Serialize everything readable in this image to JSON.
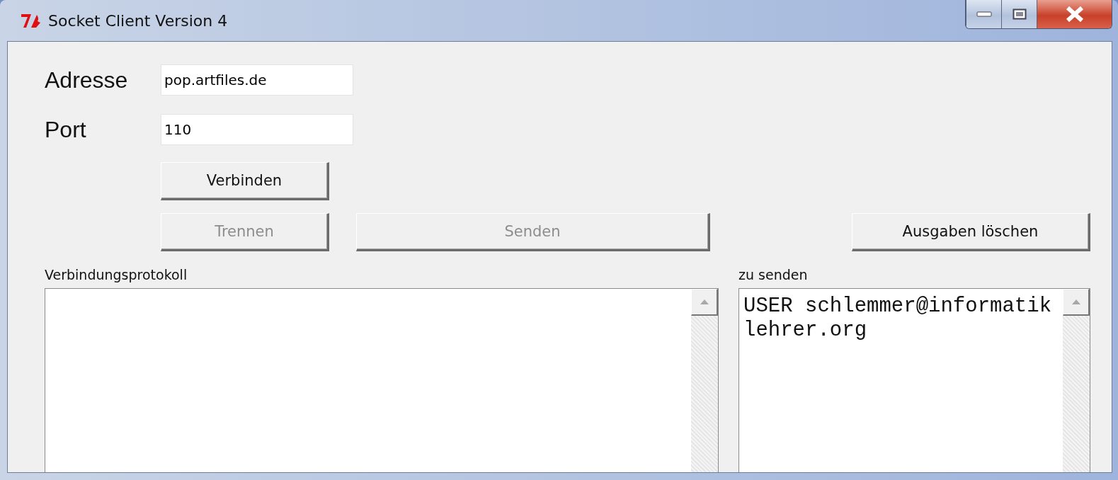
{
  "window": {
    "title": "Socket Client Version 4"
  },
  "fields": [
    {
      "label": "Adresse",
      "value": "pop.artfiles.de"
    },
    {
      "label": "Port",
      "value": "110"
    }
  ],
  "connect_button": {
    "label": "Verbinden",
    "disabled": false
  },
  "action_buttons": [
    {
      "label": "Trennen",
      "disabled": true
    },
    {
      "label": "Senden",
      "disabled": true
    }
  ],
  "clear_button": {
    "label": "Ausgaben löschen",
    "disabled": false
  },
  "log": {
    "label": "Verbindungsprotokoll"
  },
  "outgoing": {
    "label": "zu senden",
    "value": "USER schlemmer@informatiklehrer.org"
  }
}
